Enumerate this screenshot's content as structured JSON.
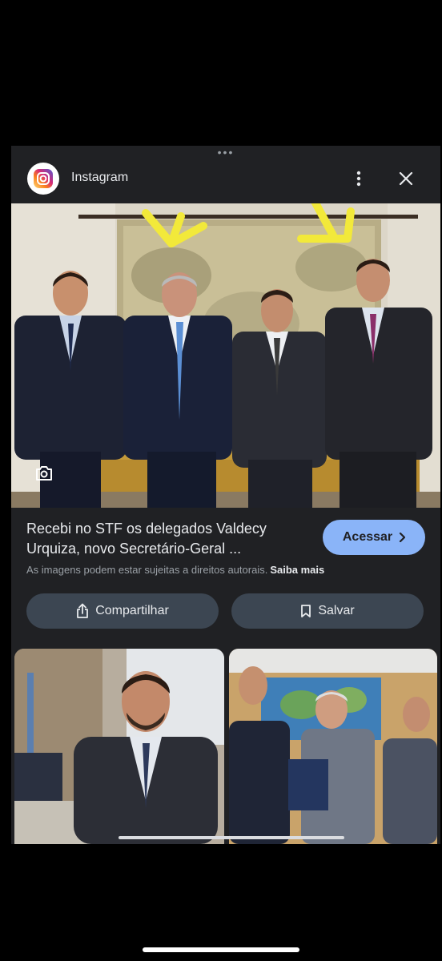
{
  "header": {
    "app_name": "Instagram",
    "app_icon": "instagram-logo",
    "more_icon": "more-vert-icon",
    "close_icon": "close-icon"
  },
  "photo": {
    "description_icon": "lens-icon"
  },
  "result": {
    "caption_line1": "Recebi no STF os delegados Valdecy",
    "caption_line2": "Urquiza, novo Secretário-Geral ...",
    "access_label": "Acessar",
    "rights_text": "As imagens podem estar sujeitas a direitos autorais.",
    "rights_link": "Saiba mais"
  },
  "actions": {
    "share_label": "Compartilhar",
    "save_label": "Salvar"
  },
  "colors": {
    "panel_bg": "#202124",
    "accent_button": "#8ab4f8",
    "action_button": "#3c4652",
    "arrow_highlight": "#f2e93a"
  }
}
